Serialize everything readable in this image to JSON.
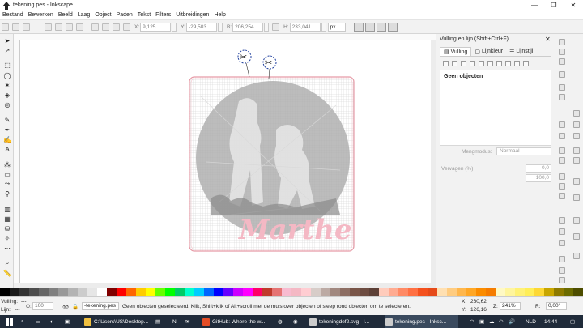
{
  "window": {
    "title": "tekening.pes - Inkscape",
    "controls": [
      "—",
      "❐",
      "✕"
    ]
  },
  "menu": [
    "Bestand",
    "Bewerken",
    "Beeld",
    "Laag",
    "Object",
    "Paden",
    "Tekst",
    "Filters",
    "Uitbreidingen",
    "Help"
  ],
  "toolbar": {
    "x_label": "X:",
    "x_value": "9,125",
    "y_label": "Y:",
    "y_value": "-29,503",
    "w_label": "B:",
    "w_value": "206,254",
    "h_label": "H:",
    "h_value": "233,041",
    "unit": "px"
  },
  "canvas": {
    "design_text": "Marthe",
    "scissor_icons": [
      "scissors-icon",
      "scissors-icon"
    ],
    "colors": {
      "page_border": "#e79aa6",
      "grid": "#bdbdbd",
      "silhouette": "#a9a9a9",
      "text": "#f4b8c4"
    }
  },
  "dialog": {
    "title": "Vulling en lijn (Shift+Ctrl+F)",
    "close": "✕",
    "tabs": [
      {
        "label": "Vulling",
        "active": true
      },
      {
        "label": "Lijnkleur",
        "active": false
      },
      {
        "label": "Lijnstijl",
        "active": false
      }
    ],
    "no_objects": "Geen objecten",
    "blend_label": "Mengmodus:",
    "blend_value": "Normaal",
    "blur_label": "Vervagen (%)",
    "blur_value": "0,0",
    "opacity_value": "100,0"
  },
  "palette_colors": [
    "#000000",
    "#1a1a1a",
    "#333333",
    "#4d4d4d",
    "#666666",
    "#808080",
    "#999999",
    "#b3b3b3",
    "#cccccc",
    "#e6e6e6",
    "#ffffff",
    "#800000",
    "#ff0000",
    "#ff6600",
    "#ffcc00",
    "#ffff00",
    "#66ff00",
    "#00ff00",
    "#00cc66",
    "#00ffcc",
    "#00ccff",
    "#0066ff",
    "#0000ff",
    "#6600ff",
    "#cc00ff",
    "#ff00ff",
    "#ff0066",
    "#c0392b",
    "#e57373",
    "#f8bbd0",
    "#f4b8c4",
    "#ffcdd2",
    "#d7ccc8",
    "#bcaaa4",
    "#a1887f",
    "#8d6e63",
    "#795548",
    "#6d4c41",
    "#5d4037",
    "#ffccbc",
    "#ffab91",
    "#ff8a65",
    "#ff7043",
    "#f4511e",
    "#e64a19",
    "#ffe0b2",
    "#ffcc80",
    "#ffb74d",
    "#ffa726",
    "#fb8c00",
    "#f57c00",
    "#fff9c4",
    "#fff59d",
    "#fff176",
    "#ffee58",
    "#fdd835",
    "#c8a600",
    "#8d7a00",
    "#6b6b00",
    "#4d4d00"
  ],
  "status": {
    "fill_label": "Vulling:",
    "fill_value": "---",
    "stroke_label": "Lijn:",
    "stroke_value": "---",
    "opacity_label": "O:",
    "opacity_value": "100",
    "layer": "-tekening.pes",
    "message": "Geen objecten geselecteerd. Klik, Shift+klik of Alt+scroll met de muis over objecten of sleep rond objecten om te selecteren.",
    "cx_label": "X:",
    "cx_value": "260,62",
    "cy_label": "Y:",
    "cy_value": "126,16",
    "zoom_label": "Z:",
    "zoom_value": "241%",
    "rot_label": "R:",
    "rot_value": "0,00°"
  },
  "taskbar": {
    "items": [
      {
        "label": "C:\\Users\\US\\Desktop...",
        "color": "#f0c040"
      },
      {
        "label": "GitHub: Where the w...",
        "color": "#e44d26"
      },
      {
        "label": "tekeningdef2.svg - I...",
        "color": "#cccccc"
      },
      {
        "label": "tekening.pes - Inksc...",
        "color": "#cccccc"
      }
    ],
    "lang": "NLD",
    "time": "14:44"
  }
}
